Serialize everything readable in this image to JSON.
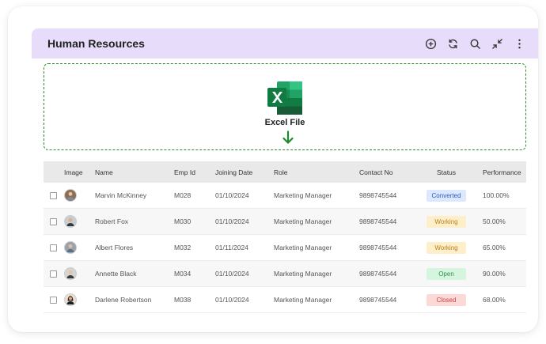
{
  "header": {
    "title": "Human Resources",
    "icons": [
      "add-circle-icon",
      "refresh-icon",
      "search-icon",
      "collapse-icon",
      "more-vertical-icon"
    ]
  },
  "dropzone": {
    "label": "Excel File",
    "icon": "excel-file-icon",
    "arrow": "down-arrow-icon",
    "accent": "#2e8b2e"
  },
  "table": {
    "columns": [
      "Image",
      "Name",
      "Emp Id",
      "Joining Date",
      "Role",
      "Contact No",
      "Status",
      "Performance"
    ],
    "rows": [
      {
        "name": "Marvin McKinney",
        "emp_id": "M028",
        "joining_date": "01/10/2024",
        "role": "Marketing Manager",
        "contact": "9898745544",
        "status": "Converted",
        "status_kind": "converted",
        "performance": "100.00%"
      },
      {
        "name": "Robert Fox",
        "emp_id": "M030",
        "joining_date": "01/10/2024",
        "role": "Marketing Manager",
        "contact": "9898745544",
        "status": "Working",
        "status_kind": "working",
        "performance": "50.00%"
      },
      {
        "name": "Albert Flores",
        "emp_id": "M032",
        "joining_date": "01/11/2024",
        "role": "Marketing Manager",
        "contact": "9898745544",
        "status": "Working",
        "status_kind": "working",
        "performance": "65.00%"
      },
      {
        "name": "Annette Black",
        "emp_id": "M034",
        "joining_date": "01/10/2024",
        "role": "Marketing Manager",
        "contact": "9898745544",
        "status": "Open",
        "status_kind": "open",
        "performance": "90.00%"
      },
      {
        "name": "Darlene Robertson",
        "emp_id": "M038",
        "joining_date": "01/10/2024",
        "role": "Marketing Manager",
        "contact": "9898745544",
        "status": "Closed",
        "status_kind": "closed",
        "performance": "68.00%"
      }
    ]
  },
  "colors": {
    "header_bg": "#e7ddfb",
    "converted": "#2f5fb4",
    "working": "#b8801d",
    "open": "#2f8f4b",
    "closed": "#c74444"
  }
}
